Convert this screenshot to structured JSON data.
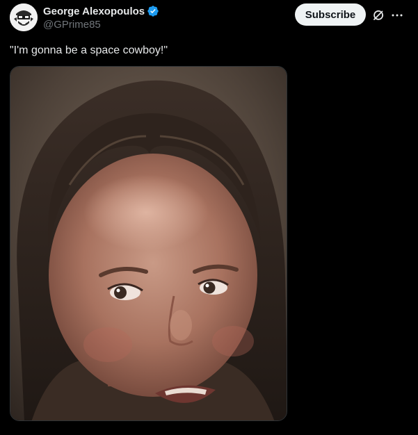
{
  "post": {
    "author": {
      "display_name": "George Alexopoulos",
      "handle": "@GPrime85",
      "verified": true,
      "verified_color": "#1d9bf0"
    },
    "subscribe_label": "Subscribe",
    "text": "\"I'm gonna be a space cowboy!\"",
    "icons": {
      "verified": "verified-badge-icon",
      "grok": "grok-icon",
      "more": "more-options-icon"
    },
    "media": {
      "type": "photo"
    }
  },
  "colors": {
    "background": "#000000",
    "text_primary": "#e7e9ea",
    "text_secondary": "#71767b",
    "subscribe_bg": "#eff3f4",
    "subscribe_text": "#0f1419"
  }
}
